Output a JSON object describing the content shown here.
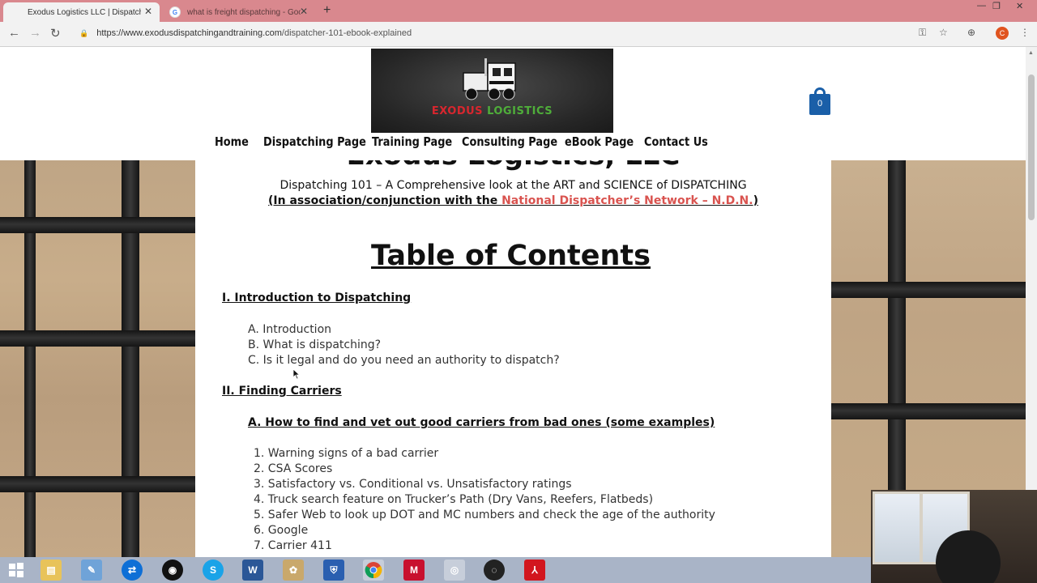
{
  "browser": {
    "tabs": [
      {
        "title": "Exodus Logistics LLC | Dispatcher",
        "active": true
      },
      {
        "title": "what is freight dispatching - Goo",
        "active": false
      }
    ],
    "url_domain": "https://www.exodusdispatchingandtraining.com",
    "url_path": "/dispatcher-101-ebook-explained",
    "profile_initial": "C"
  },
  "site": {
    "logo_word1": "EXODUS",
    "logo_word2": "LOGISTICS",
    "cart_count": "0",
    "nav": [
      "Home",
      "Dispatching Page",
      "Training Page",
      "Consulting Page",
      "eBook Page",
      "Contact Us"
    ]
  },
  "article": {
    "site_title": "Exodus Logistics, LLC",
    "subtitle": "Dispatching 101 – A Comprehensive look at the ART and SCIENCE of DISPATCHING",
    "assoc_prefix": "(In association/conjunction with the ",
    "assoc_link": "National Dispatcher’s Network – N.D.N.",
    "assoc_suffix": ")",
    "toc_title": "Table of Contents",
    "section1": "I.  Introduction to Dispatching",
    "section1_items": [
      "A. Introduction",
      "B. What is dispatching?",
      "C. Is it legal and do you need an authority to dispatch?"
    ],
    "section2": "II. Finding Carriers",
    "section2_sub": "A. How to find and vet out good carriers from bad ones (some examples)",
    "section2_items": [
      "1. Warning signs of a bad carrier",
      "2. CSA Scores",
      "3. Satisfactory vs. Conditional vs. Unsatisfactory ratings",
      "4. Truck search feature on Trucker’s Path (Dry Vans, Reefers, Flatbeds)",
      "5. Safer Web to look up DOT and MC numbers and check the age of the authority",
      "6. Google",
      "7. Carrier 411"
    ]
  },
  "colors": {
    "tabbar": "#d9888e",
    "link": "#d9534f",
    "cart": "#1a5fa8",
    "taskbar": "#a9b4c7"
  },
  "taskbar_icons": [
    "windows-start",
    "file-explorer",
    "notepad",
    "teamviewer",
    "media-player",
    "skype",
    "word",
    "paint",
    "security",
    "chrome",
    "mcafee",
    "camera",
    "obs",
    "acrobat"
  ]
}
